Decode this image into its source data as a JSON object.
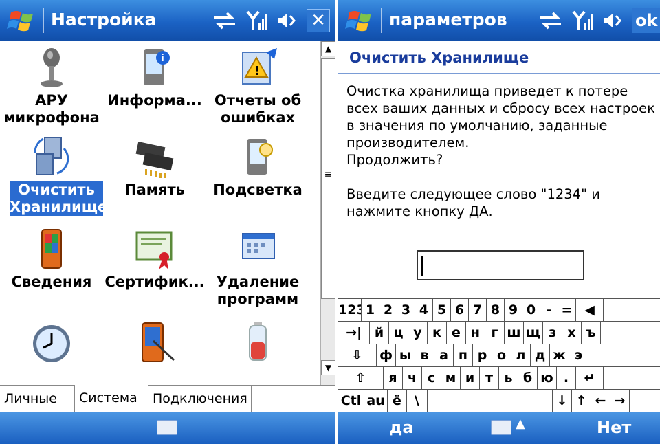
{
  "left": {
    "title": "Настройка",
    "close_label": "✕",
    "icons": [
      {
        "label": "АРУ микрофона",
        "icon": "microphone-icon"
      },
      {
        "label": "Информа...",
        "icon": "device-info-icon"
      },
      {
        "label": "Отчеты об ошибках",
        "icon": "error-report-icon"
      },
      {
        "label": "Очистить Хранилище",
        "icon": "clear-storage-icon",
        "selected": true
      },
      {
        "label": "Память",
        "icon": "memory-chip-icon"
      },
      {
        "label": "Подсветка",
        "icon": "backlight-icon"
      },
      {
        "label": "Сведения",
        "icon": "about-device-icon"
      },
      {
        "label": "Сертифик...",
        "icon": "certificate-icon"
      },
      {
        "label": "Удаление программ",
        "icon": "remove-programs-icon"
      },
      {
        "label": "",
        "icon": "clock-icon"
      },
      {
        "label": "",
        "icon": "screen-stylus-icon"
      },
      {
        "label": "",
        "icon": "battery-icon"
      }
    ],
    "tabs": [
      "Личные",
      "Система",
      "Подключения"
    ],
    "active_tab": "Система"
  },
  "right": {
    "title": "параметров",
    "ok_label": "ok",
    "dialog_title": "Очистить Хранилище",
    "body_lines": [
      "Очистка хранилища приведет к потере",
      "всех ваших данных и сбросу всех настроек",
      "в значения по умолчанию, заданные",
      "производителем.",
      "Продолжить?"
    ],
    "instruction_lines": [
      "Введите следующее слово \"1234\" и",
      "нажмите кнопку ДА."
    ],
    "input_value": "",
    "keyboard": {
      "row1": [
        "123",
        "1",
        "2",
        "3",
        "4",
        "5",
        "6",
        "7",
        "8",
        "9",
        "0",
        "-",
        "=",
        "◀"
      ],
      "row2": [
        "→|",
        "й",
        "ц",
        "у",
        "к",
        "е",
        "н",
        "г",
        "ш",
        "щ",
        "з",
        "х",
        "ъ"
      ],
      "row3": [
        "⇩",
        "ф",
        "ы",
        "в",
        "а",
        "п",
        "р",
        "о",
        "л",
        "д",
        "ж",
        "э"
      ],
      "row4": [
        "⇧",
        "я",
        "ч",
        "с",
        "м",
        "и",
        "т",
        "ь",
        "б",
        "ю",
        ".",
        "↵"
      ],
      "row5": [
        "Ctl",
        "au",
        "ё",
        "\\",
        "",
        "↓",
        "↑",
        "←",
        "→"
      ]
    },
    "left_softkey": "да",
    "right_softkey": "Нет"
  },
  "colors": {
    "titlebar": "#1b62c4",
    "selection": "#2a6bd0",
    "dialog_title": "#1a3c9c"
  }
}
